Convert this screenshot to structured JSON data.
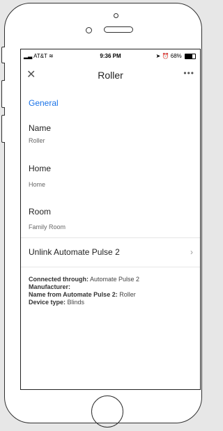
{
  "status_bar": {
    "carrier": "AT&T",
    "time": "9:36 PM",
    "battery": "68%",
    "battery_level": 0.68
  },
  "nav": {
    "close_icon": "close-icon",
    "title": "Roller",
    "more_icon": "more-horizontal-icon"
  },
  "general": {
    "section_title": "General",
    "name_label": "Name",
    "name_value": "Roller",
    "home_label": "Home",
    "home_value": "Home",
    "room_label": "Room",
    "room_value": "Family Room"
  },
  "unlink": {
    "label": "Unlink Automate Pulse 2"
  },
  "info": {
    "connected_key": "Connected through:",
    "connected_val": "Automate Pulse 2",
    "manufacturer_key": "Manufacturer:",
    "manufacturer_val": "",
    "name_from_key": "Name from Automate Pulse 2:",
    "name_from_val": "Roller",
    "device_type_key": "Device type:",
    "device_type_val": "Blinds"
  },
  "colors": {
    "accent": "#1a73e8",
    "text": "#222222",
    "muted": "#666666"
  }
}
